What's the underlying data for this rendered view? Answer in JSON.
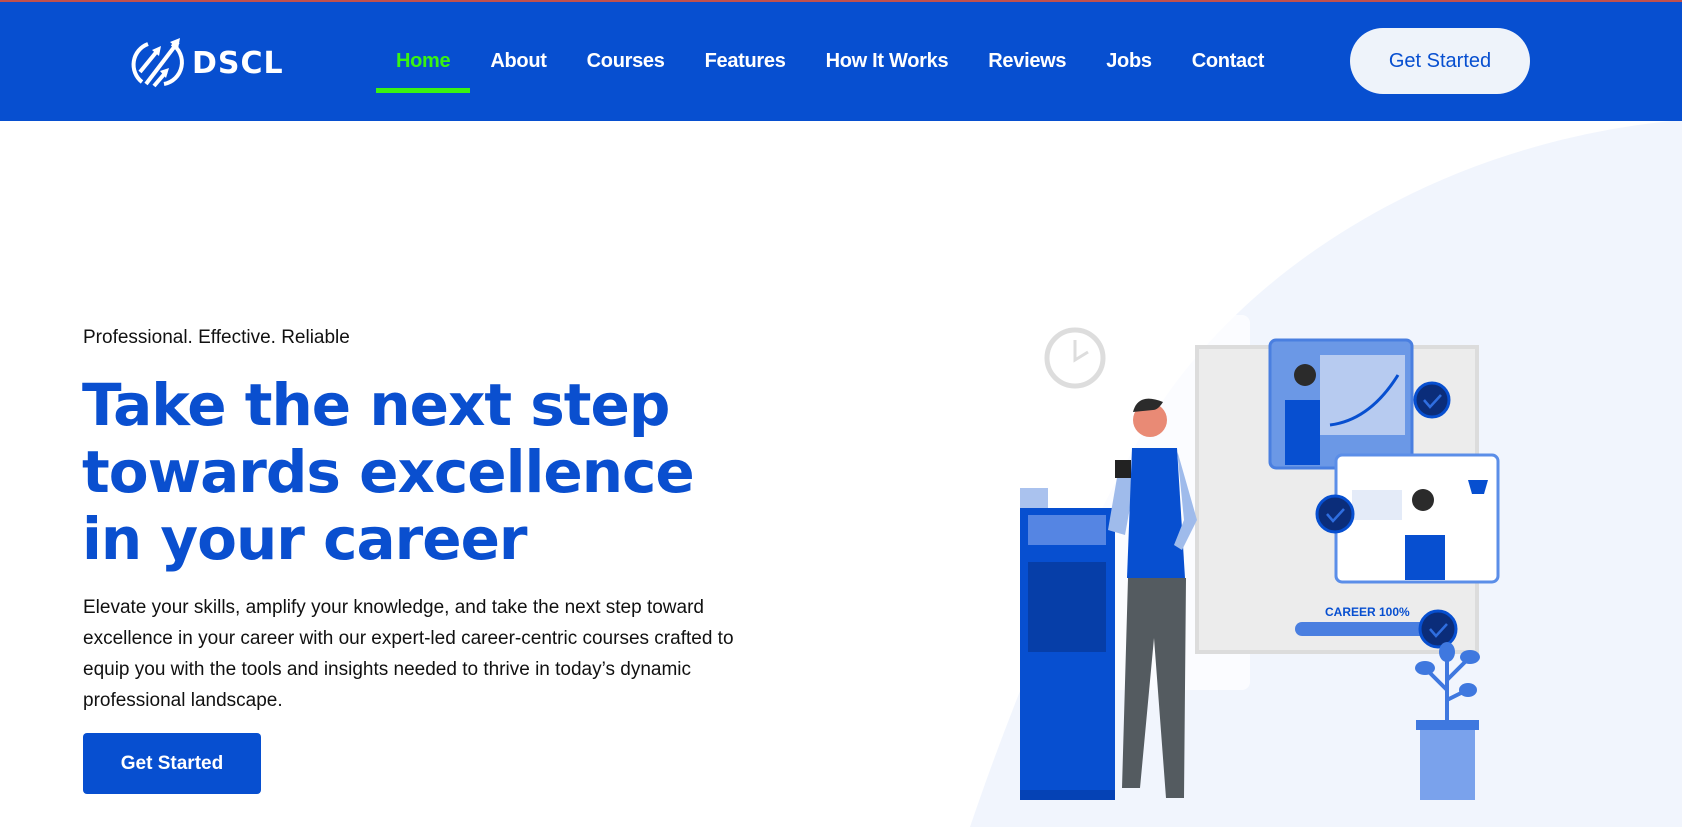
{
  "header": {
    "logo_text": "DSCL",
    "nav": [
      "Home",
      "About",
      "Courses",
      "Features",
      "How It Works",
      "Reviews",
      "Jobs",
      "Contact"
    ],
    "active": "Home",
    "cta": "Get Started"
  },
  "hero": {
    "tagline": "Professional. Effective. Reliable",
    "title": "Take the next step towards excellence in your career",
    "description": "Elevate your skills, amplify your knowledge, and take the next step toward excellence in your career with our expert-led career-centric courses crafted to equip you with the tools and insights needed to thrive in today’s dynamic professional landscape.",
    "cta": "Get Started"
  },
  "illustration": {
    "progress_label": "CAREER 100%",
    "progress": 100
  },
  "colors": {
    "brand": "#074fd0",
    "active": "#39f311",
    "bg_shape": "#f1f5fd"
  }
}
